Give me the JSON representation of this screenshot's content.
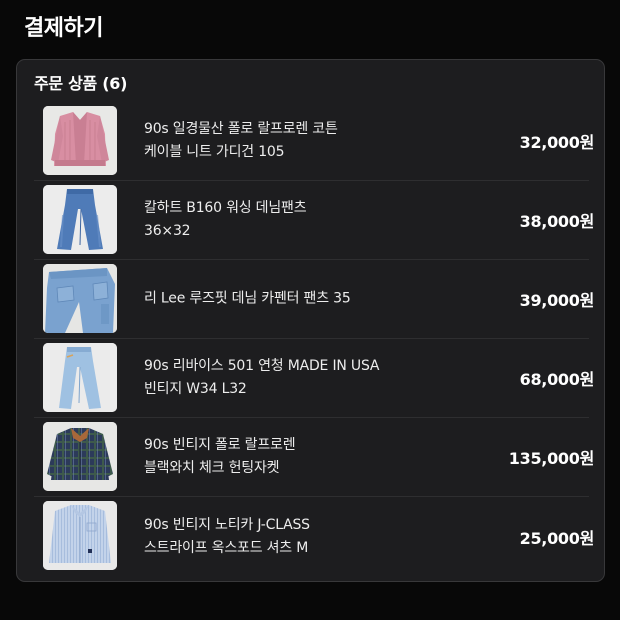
{
  "page": {
    "title": "결제하기"
  },
  "order": {
    "title": "주문 상품 (6)",
    "items": [
      {
        "name_line1": "90s 일경물산 폴로 랄프로렌 코튼",
        "name_line2": "케이블 니트 가디건 105",
        "price": "32,000원",
        "image": "pink-knit-cardigan-photo"
      },
      {
        "name_line1": "칼하트 B160 워싱 데님팬츠",
        "name_line2": "36×32",
        "price": "38,000원",
        "image": "blue-denim-pants-photo"
      },
      {
        "name_line1": "리 Lee 루즈핏 데님 카펜터 팬츠 35",
        "name_line2": "",
        "price": "39,000원",
        "image": "light-carpenter-jeans-photo"
      },
      {
        "name_line1": "90s 리바이스 501 연청 MADE IN USA",
        "name_line2": "빈티지 W34 L32",
        "price": "68,000원",
        "image": "light-wash-levis-jeans-photo"
      },
      {
        "name_line1": "90s 빈티지 폴로 랄프로렌",
        "name_line2": "블랙와치 체크 헌팅자켓",
        "price": "135,000원",
        "image": "plaid-hunting-jacket-photo"
      },
      {
        "name_line1": "90s 빈티지 노티카 J-CLASS",
        "name_line2": "스트라이프 옥스포드 셔츠 M",
        "price": "25,000원",
        "image": "striped-oxford-shirt-photo"
      }
    ]
  }
}
